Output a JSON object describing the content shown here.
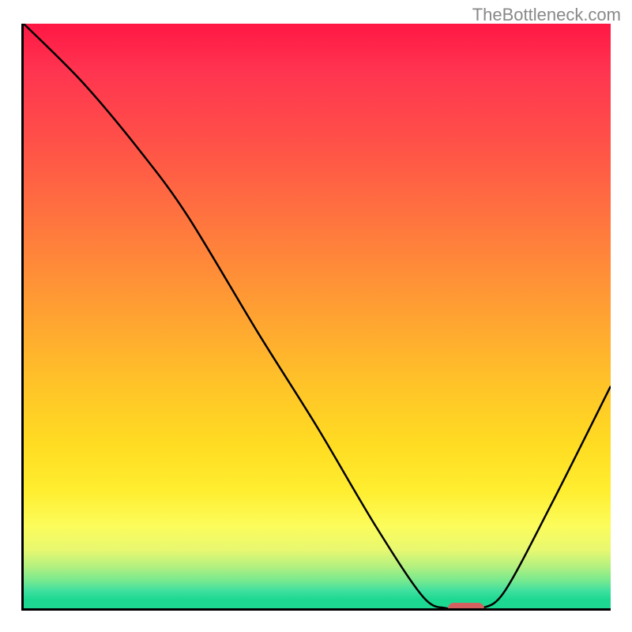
{
  "watermark": "TheBottleneck.com",
  "chart_data": {
    "type": "line",
    "title": "",
    "xlabel": "",
    "ylabel": "",
    "xlim": [
      0,
      100
    ],
    "ylim": [
      0,
      100
    ],
    "x": [
      0,
      10,
      20,
      28,
      40,
      50,
      60,
      68,
      72,
      75,
      78,
      82,
      90,
      100
    ],
    "values": [
      100,
      90,
      78,
      67,
      47,
      31,
      14,
      2,
      0,
      0,
      0,
      3,
      18,
      38
    ],
    "marker_x": 75,
    "marker_y": 0
  }
}
